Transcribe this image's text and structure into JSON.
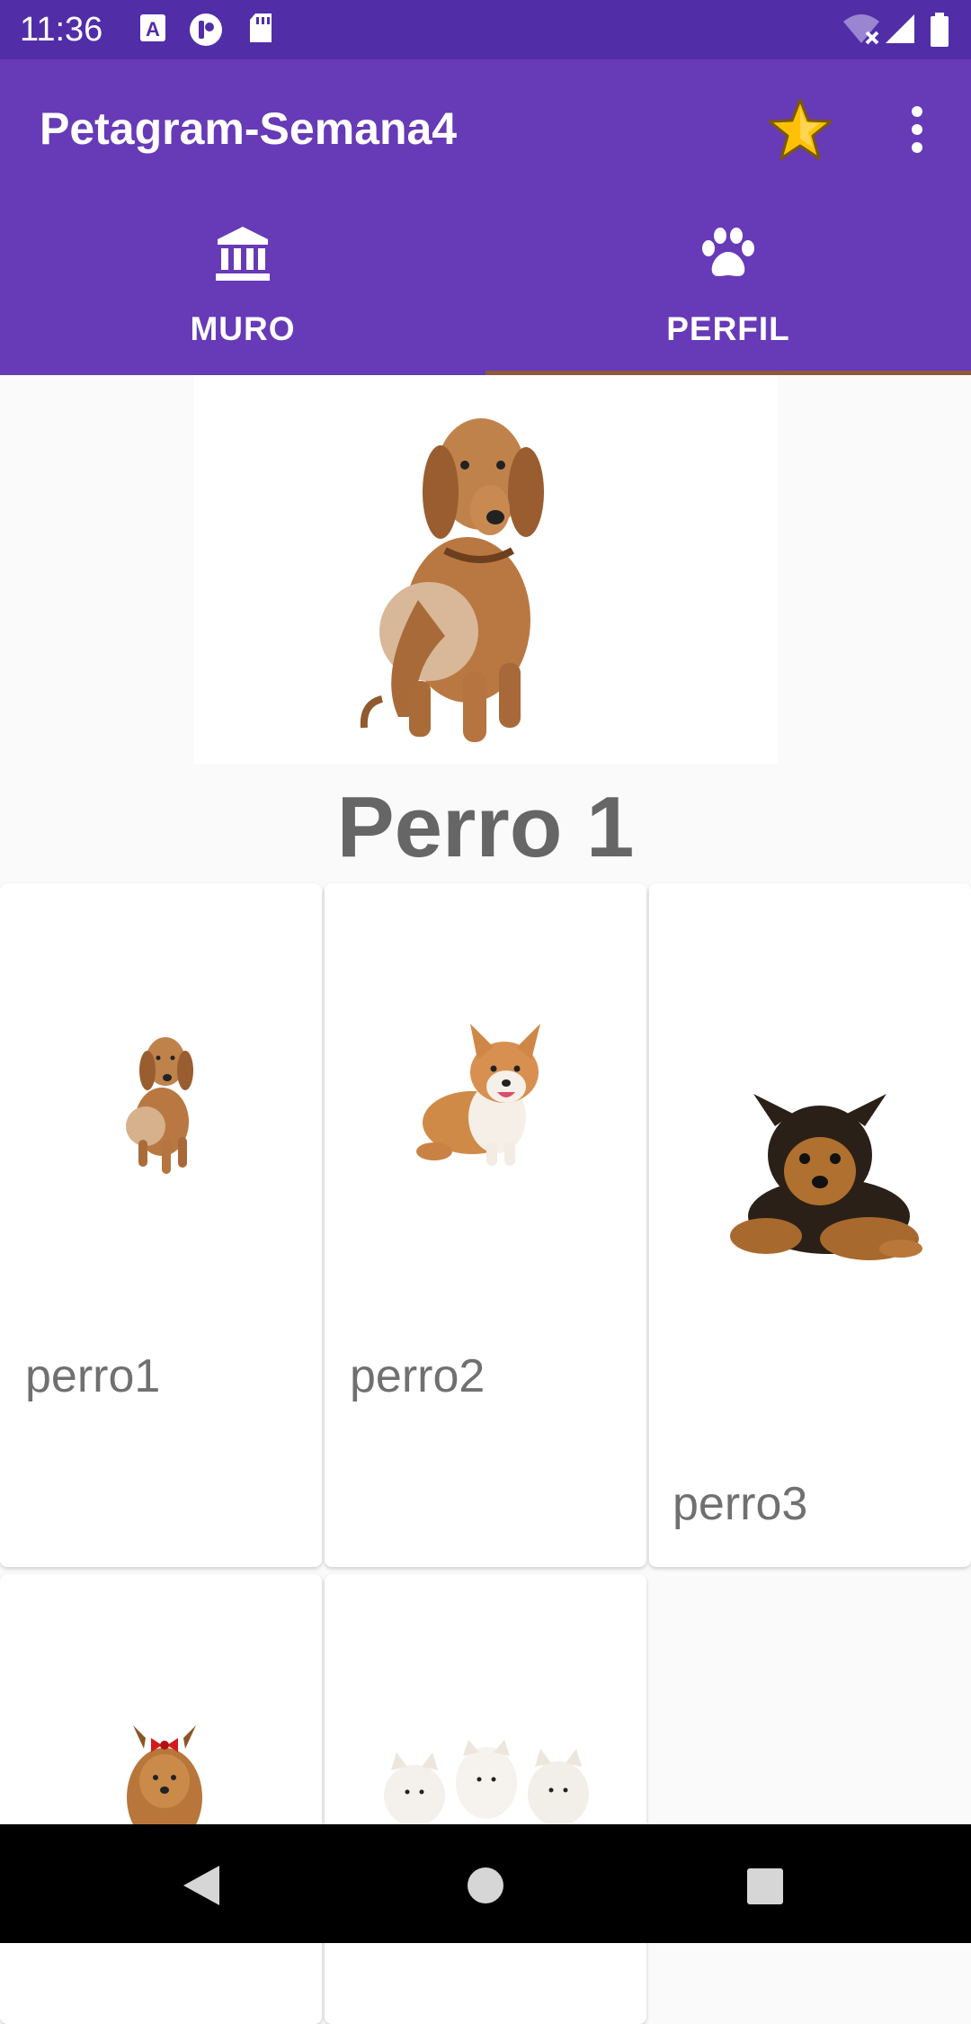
{
  "status_bar": {
    "time": "11:36",
    "left_icons": [
      "a-notification-icon",
      "record-icon",
      "sd-card-icon"
    ],
    "right_icons": [
      "wifi-off-icon",
      "signal-icon",
      "battery-icon"
    ]
  },
  "app_bar": {
    "title": "Petagram-Semana4",
    "star_icon": "star-icon",
    "menu_icon": "more-vert-icon"
  },
  "tabs": [
    {
      "label": "MURO",
      "icon": "museum-icon",
      "selected": false
    },
    {
      "label": "PERFIL",
      "icon": "paw-icon",
      "selected": true
    }
  ],
  "profile": {
    "name": "Perro 1"
  },
  "grid": [
    {
      "label": "perro1"
    },
    {
      "label": "perro2"
    },
    {
      "label": "perro3"
    },
    {
      "label": ""
    },
    {
      "label": ""
    }
  ],
  "colors": {
    "status_bar": "#512da8",
    "app_bar": "#673ab7",
    "tab_indicator": "#8d5a3b",
    "profile_name": "#666666"
  },
  "nav_bar": {
    "buttons": [
      "back-icon",
      "home-icon",
      "recents-icon"
    ]
  }
}
